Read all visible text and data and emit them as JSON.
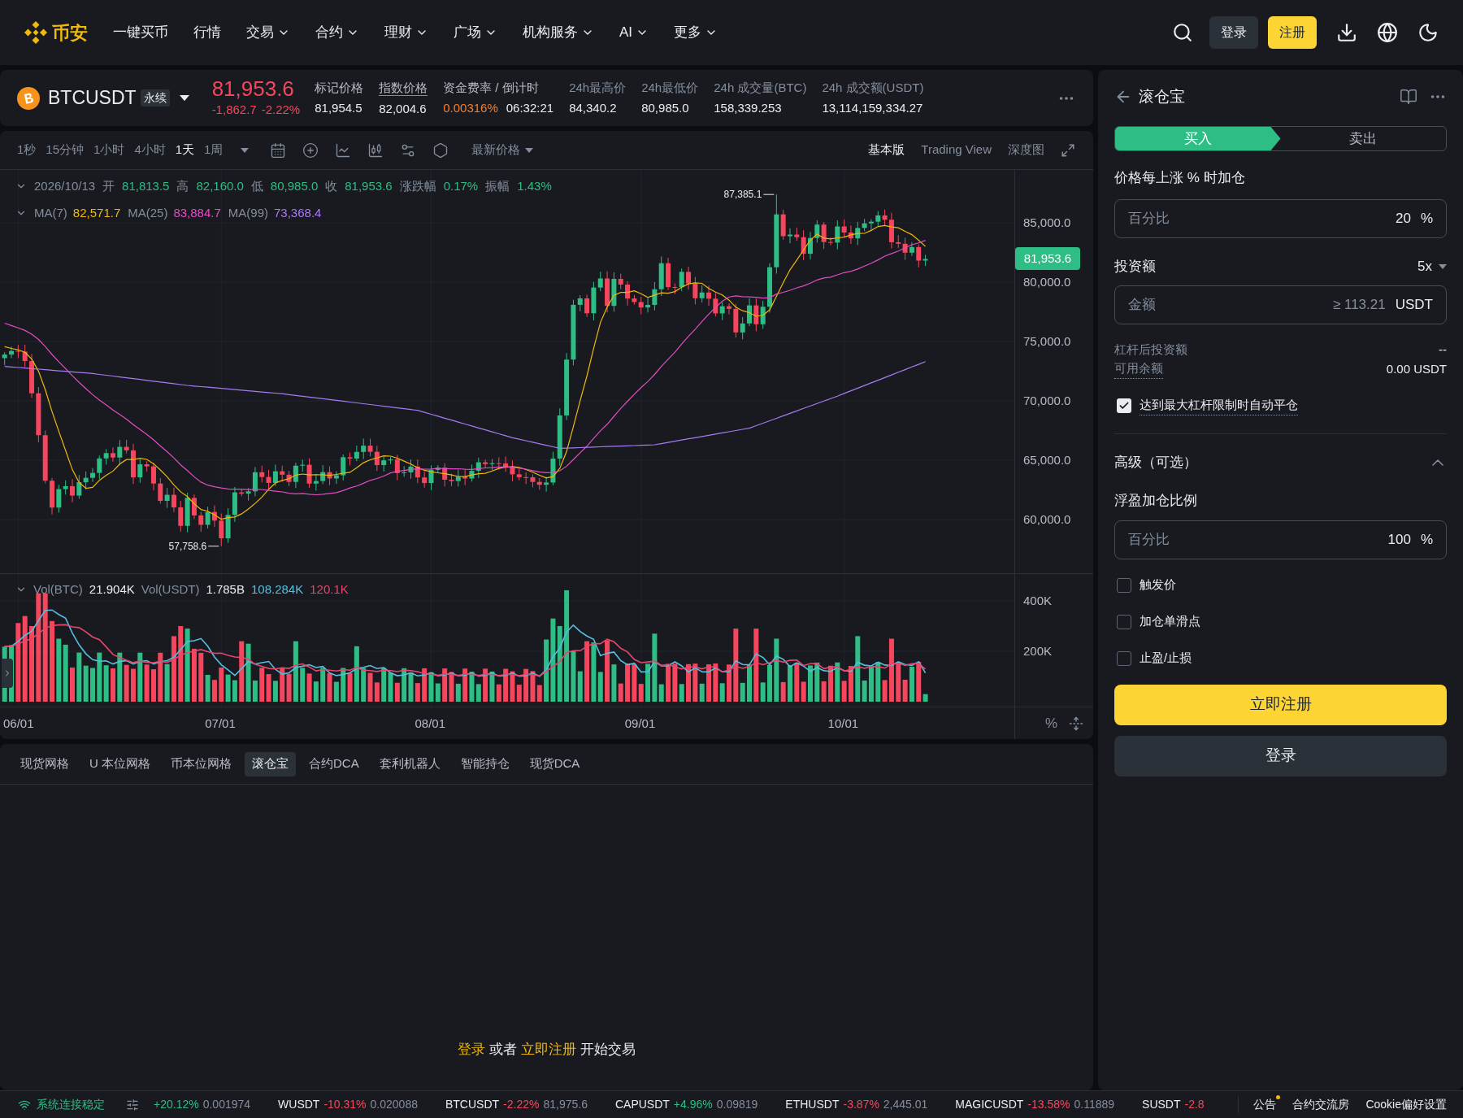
{
  "nav": {
    "logo_text": "币安",
    "items": [
      {
        "label": "一键买币",
        "dropdown": false
      },
      {
        "label": "行情",
        "dropdown": false
      },
      {
        "label": "交易",
        "dropdown": true
      },
      {
        "label": "合约",
        "dropdown": true
      },
      {
        "label": "理财",
        "dropdown": true
      },
      {
        "label": "广场",
        "dropdown": true
      },
      {
        "label": "机构服务",
        "dropdown": true
      },
      {
        "label": "AI",
        "dropdown": true
      },
      {
        "label": "更多",
        "dropdown": true
      }
    ],
    "login": "登录",
    "register": "注册"
  },
  "ticker": {
    "symbol": "BTCUSDT",
    "contract_type": "永续",
    "last_price": "81,953.6",
    "change": "-1,862.7",
    "change_percent": "-2.22%",
    "kind": "loss",
    "stats": [
      {
        "label": "标记价格",
        "kind": "hint",
        "underlined": false,
        "values": [
          {
            "text": "81,954.5",
            "kind": "plain"
          }
        ]
      },
      {
        "label": "指数价格",
        "kind": "hint",
        "underlined": true,
        "values": [
          {
            "text": "82,004.6",
            "kind": "plain"
          }
        ]
      },
      {
        "label": "资金费率 / 倒计时",
        "kind": "hint",
        "underlined": false,
        "values": [
          {
            "text": "0.00316%",
            "kind": "highlight"
          },
          {
            "text": "06:32:21",
            "kind": "plain"
          }
        ]
      },
      {
        "label": "24h最高价",
        "kind": "plain",
        "underlined": false,
        "values": [
          {
            "text": "84,340.2",
            "kind": "plain"
          }
        ]
      },
      {
        "label": "24h最低价",
        "kind": "plain",
        "underlined": false,
        "values": [
          {
            "text": "80,985.0",
            "kind": "plain"
          }
        ]
      },
      {
        "label": "24h 成交量(BTC)",
        "kind": "plain",
        "underlined": false,
        "values": [
          {
            "text": "158,339.253",
            "kind": "plain"
          }
        ]
      },
      {
        "label": "24h 成交额(USDT)",
        "kind": "plain",
        "underlined": false,
        "values": [
          {
            "text": "13,114,159,334.27",
            "kind": "plain"
          }
        ]
      }
    ]
  },
  "chart": {
    "intervals": [
      {
        "label": "1秒",
        "selected": false
      },
      {
        "label": "15分钟",
        "selected": false
      },
      {
        "label": "1小时",
        "selected": false
      },
      {
        "label": "4小时",
        "selected": false
      },
      {
        "label": "1天",
        "selected": true
      },
      {
        "label": "1周",
        "selected": false
      }
    ],
    "price_type": "最新价格",
    "views": [
      {
        "label": "基本版",
        "selected": true
      },
      {
        "label": "Trading View",
        "selected": false
      },
      {
        "label": "深度图",
        "selected": false
      }
    ],
    "ohlc_legend": {
      "date": "2026/10/13",
      "items": [
        {
          "label": "开",
          "value": "81,813.5"
        },
        {
          "label": "高",
          "value": "82,160.0"
        },
        {
          "label": "低",
          "value": "80,985.0"
        },
        {
          "label": "收",
          "value": "81,953.6"
        },
        {
          "label": "涨跌幅",
          "value": "0.17%"
        },
        {
          "label": "振幅",
          "value": "1.43%"
        }
      ]
    },
    "ma_legend": [
      {
        "label": "MA(7)",
        "value": "82,571.7",
        "color": "#f0b90b"
      },
      {
        "label": "MA(25)",
        "value": "83,884.7",
        "color": "#e24ec1"
      },
      {
        "label": "MA(99)",
        "value": "73,368.4",
        "color": "#a77bf3"
      }
    ],
    "high_marker": "87,385.1",
    "low_marker": "57,758.6",
    "price_axis": [
      "85,000.0",
      "80,000.0",
      "75,000.0",
      "70,000.0",
      "65,000.0",
      "60,000.0"
    ],
    "current_price_tag": "81,953.6",
    "volume_legend": [
      {
        "label": "Vol(BTC)",
        "value": "21.904K"
      },
      {
        "label": "Vol(USDT)",
        "value": "1.785B"
      }
    ],
    "volume_ma": [
      {
        "value": "108.284K",
        "color": "#56bfe0"
      },
      {
        "value": "120.1K",
        "color": "#e8456d"
      }
    ],
    "volume_axis": [
      "400K",
      "200K"
    ],
    "date_axis": [
      "06/01",
      "07/01",
      "08/01",
      "09/01",
      "10/01"
    ],
    "percent_toggle": "%"
  },
  "bot_tabs": [
    {
      "label": "现货网格",
      "selected": false
    },
    {
      "label": "U 本位网格",
      "selected": false
    },
    {
      "label": "币本位网格",
      "selected": false
    },
    {
      "label": "滚仓宝",
      "selected": true
    },
    {
      "label": "合约DCA",
      "selected": false
    },
    {
      "label": "套利机器人",
      "selected": false
    },
    {
      "label": "智能持仓",
      "selected": false
    },
    {
      "label": "现货DCA",
      "selected": false
    }
  ],
  "login_prompt": {
    "login": "登录",
    "or": "或者",
    "register": "立即注册",
    "suffix": "开始交易"
  },
  "panel": {
    "title": "滚仓宝",
    "sides": [
      {
        "label": "买入",
        "selected": true
      },
      {
        "label": "卖出",
        "selected": false
      }
    ],
    "step_label": "价格每上涨 % 时加仓",
    "step_field": {
      "prefix": "百分比",
      "value": "20",
      "unit": "%"
    },
    "amount_label": "投资额",
    "leverage": "5x",
    "amount_field": {
      "prefix": "金额",
      "placeholder": "≥ 113.21",
      "unit": "USDT"
    },
    "info_rows": [
      {
        "label": "杠杆后投资额",
        "value": "--",
        "underlined": false
      },
      {
        "label": "可用余额",
        "value": "0.00 USDT",
        "underlined": true
      }
    ],
    "auto_close": {
      "label": "达到最大杠杆限制时自动平仓",
      "checked": true
    },
    "advanced": {
      "title": "高级（可选）",
      "expanded": true,
      "ratio_label": "浮盈加仓比例",
      "ratio_field": {
        "prefix": "百分比",
        "value": "100",
        "unit": "%"
      },
      "options": [
        {
          "label": "触发价",
          "checked": false
        },
        {
          "label": "加仓单滑点",
          "checked": false
        },
        {
          "label": "止盈/止损",
          "checked": false
        }
      ]
    },
    "register_button": "立即注册",
    "login_button": "登录"
  },
  "status_bar": {
    "connection": "系统连接稳定",
    "tickers": [
      {
        "change": "+20.12%",
        "price": "0.001974",
        "kind": "gain"
      },
      {
        "symbol": "WUSDT",
        "change": "-10.31%",
        "price": "0.020088",
        "kind": "loss"
      },
      {
        "symbol": "BTCUSDT",
        "change": "-2.22%",
        "price": "81,975.6",
        "kind": "loss"
      },
      {
        "symbol": "CAPUSDT",
        "change": "+4.96%",
        "price": "0.09819",
        "kind": "gain"
      },
      {
        "symbol": "ETHUSDT",
        "change": "-3.87%",
        "price": "2,445.01",
        "kind": "loss"
      },
      {
        "symbol": "MAGICUSDT",
        "change": "-13.58%",
        "price": "0.11889",
        "kind": "loss"
      },
      {
        "symbol": "SUSDT",
        "change": "-2.8",
        "kind": "loss"
      }
    ],
    "links": [
      {
        "label": "公告",
        "badge": true
      },
      {
        "label": "合约交流房",
        "badge": false
      },
      {
        "label": "Cookie偏好设置",
        "badge": false
      }
    ]
  }
}
